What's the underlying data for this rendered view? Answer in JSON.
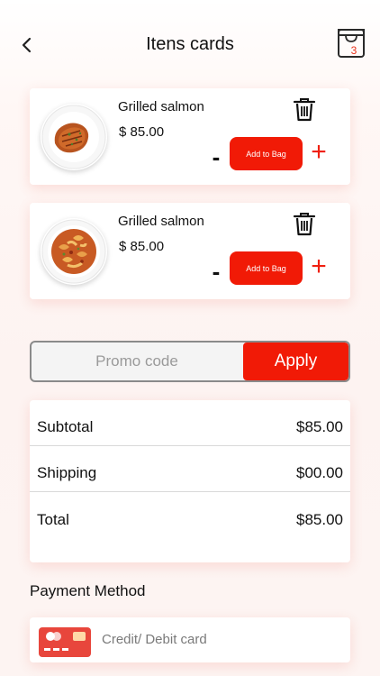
{
  "header": {
    "title": "Itens cards",
    "bag_count": "3"
  },
  "items": [
    {
      "name": "Grilled salmon",
      "price": "$ 85.00",
      "minus_label": "-",
      "add_label": "Add to Bag",
      "plus_label": "+",
      "image": "grilled-salmon-plate"
    },
    {
      "name": "Grilled salmon",
      "price": "$ 85.00",
      "minus_label": "-",
      "add_label": "Add to Bag",
      "plus_label": "+",
      "image": "pasta-plate"
    }
  ],
  "promo": {
    "placeholder": "Promo code",
    "value": "",
    "apply_label": "Apply"
  },
  "summary": {
    "subtotal_label": "Subtotal",
    "subtotal_value": "$85.00",
    "shipping_label": "Shipping",
    "shipping_value": "$00.00",
    "total_label": "Total",
    "total_value": "$85.00"
  },
  "payment": {
    "heading": "Payment Method",
    "method_label": "Credit/ Debit card",
    "icon": "credit-card-icon"
  },
  "colors": {
    "accent": "#f11a06",
    "card_icon": "#e8463c",
    "divider": "#d9d9d9"
  }
}
